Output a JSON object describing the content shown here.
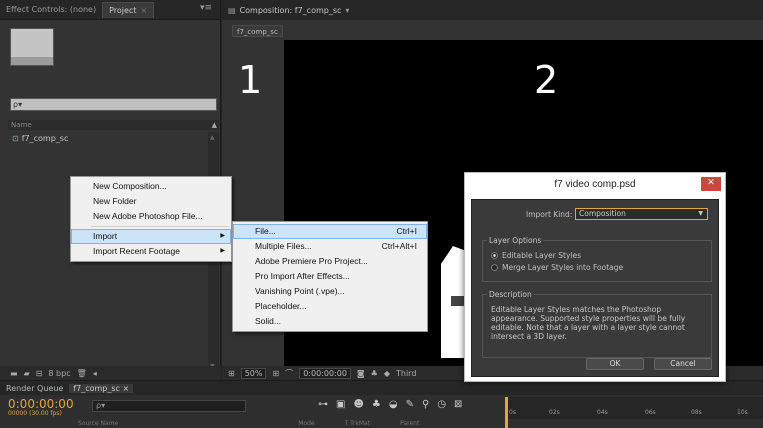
{
  "project_panel": {
    "tab_effect_controls": "Effect Controls: (none)",
    "tab_project": "Project",
    "search_placeholder": "ρ▾",
    "col_name": "Name",
    "item_name": "f7_comp_sc",
    "footer_bpc": "8 bpc"
  },
  "comp_panel": {
    "tab_title": "Composition: f7_comp_sc",
    "sub_tab": "f7_comp_sc",
    "label_1": "1",
    "label_2": "2",
    "zoom": "50%",
    "timecode": "0:00:00:00",
    "view": "Third"
  },
  "timeline": {
    "tab_render_queue": "Render Queue",
    "tab_comp": "f7_comp_sc",
    "current_time": "0:00:00:00",
    "time_sub": "00000 (30.00 fps)",
    "search_placeholder": "ρ▾",
    "ticks": [
      "0s",
      "02s",
      "04s",
      "06s",
      "08s",
      "10s"
    ],
    "col_source": "Source Name",
    "col_mode": "Mode",
    "col_trkmat": "T  TrkMat",
    "col_parent": "Parent"
  },
  "context_menu": {
    "items": [
      {
        "label": "New Composition..."
      },
      {
        "label": "New Folder"
      },
      {
        "label": "New Adobe Photoshop File..."
      },
      {
        "label": "Import"
      },
      {
        "label": "Import Recent Footage"
      }
    ]
  },
  "import_submenu": {
    "items": [
      {
        "label": "File...",
        "shortcut": "Ctrl+I"
      },
      {
        "label": "Multiple Files...",
        "shortcut": "Ctrl+Alt+I"
      },
      {
        "label": "Adobe Premiere Pro Project..."
      },
      {
        "label": "Pro Import After Effects..."
      },
      {
        "label": "Vanishing Point (.vpe)..."
      },
      {
        "label": "Placeholder..."
      },
      {
        "label": "Solid..."
      }
    ]
  },
  "dialog": {
    "title": "f7 video comp.psd",
    "close_glyph": "✕",
    "import_kind_label": "Import Kind:",
    "import_kind_value": "Composition",
    "layer_options_title": "Layer Options",
    "option_editable": "Editable Layer Styles",
    "option_merge": "Merge Layer Styles into Footage",
    "description_title": "Description",
    "description_text": "Editable Layer Styles matches the Photoshop appearance. Supported style properties will be fully editable. Note that a layer with a layer style cannot intersect a 3D layer.",
    "ok_label": "OK",
    "cancel_label": "Cancel"
  }
}
